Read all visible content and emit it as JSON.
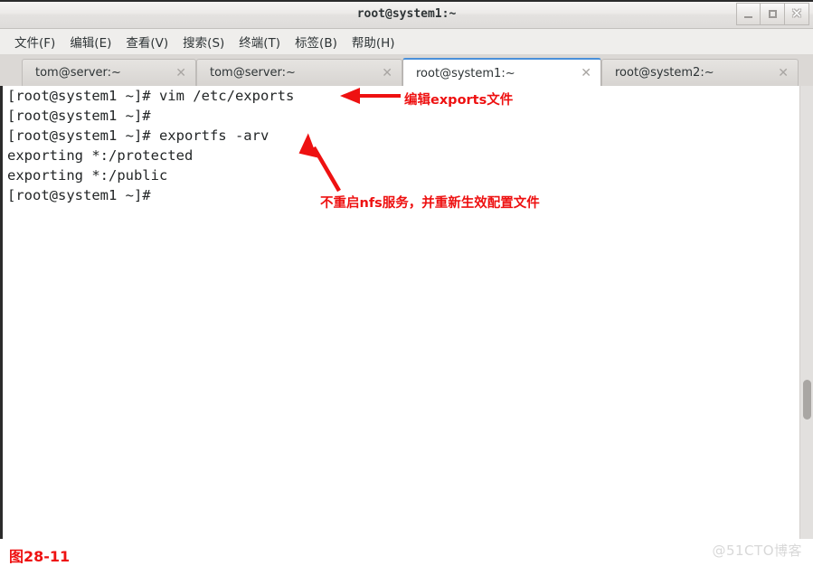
{
  "window": {
    "title": "root@system1:~",
    "buttons": [
      {
        "name": "minimize",
        "label": "_"
      },
      {
        "name": "maximize",
        "label": "□"
      },
      {
        "name": "close",
        "label": "✕"
      }
    ]
  },
  "menubar": {
    "items": [
      {
        "label": "文件(F)"
      },
      {
        "label": "编辑(E)"
      },
      {
        "label": "查看(V)"
      },
      {
        "label": "搜索(S)"
      },
      {
        "label": "终端(T)"
      },
      {
        "label": "标签(B)"
      },
      {
        "label": "帮助(H)"
      }
    ]
  },
  "tabs": {
    "close_glyph": "✕",
    "items": [
      {
        "label": "tom@server:~",
        "active": false
      },
      {
        "label": "tom@server:~",
        "active": false
      },
      {
        "label": "root@system1:~",
        "active": true
      },
      {
        "label": "root@system2:~",
        "active": false
      }
    ]
  },
  "terminal": {
    "lines": [
      "[root@system1 ~]# vim /etc/exports",
      "[root@system1 ~]#",
      "[root@system1 ~]# exportfs -arv",
      "exporting *:/protected",
      "exporting *:/public",
      "[root@system1 ~]#"
    ],
    "full_text": "[root@system1 ~]# vim /etc/exports\n[root@system1 ~]#\n[root@system1 ~]# exportfs -arv\nexporting *:/protected\nexporting *:/public\n[root@system1 ~]#"
  },
  "annotations": {
    "color": "#ee1111",
    "items": [
      {
        "text": "编辑exports文件",
        "arrow": "left-arrow"
      },
      {
        "text": "不重启nfs服务，并重新生效配置文件",
        "arrow": "up-left-diagonal-arrow"
      }
    ]
  },
  "footer": {
    "figure_caption": "图28-11",
    "watermark": "@51CTO博客"
  },
  "scrollbar": {
    "thumb_top_pct": 65
  }
}
